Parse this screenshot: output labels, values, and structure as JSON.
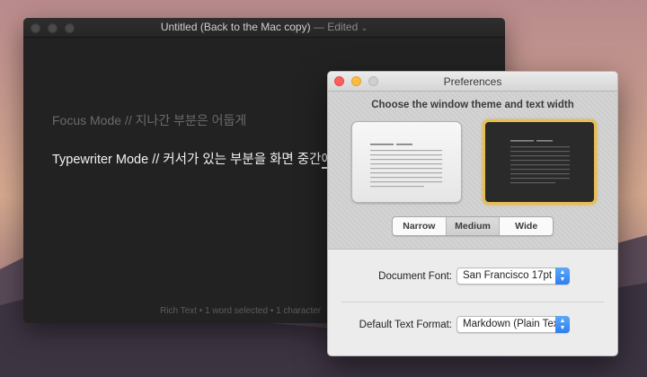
{
  "editor": {
    "title": "Untitled (Back to the Mac copy)",
    "edited_label": "— Edited",
    "focus_line": "Focus Mode // 지나간 부분은 어둡게",
    "typewriter_line_main": "Typewriter Mode // 커서가 있는 부분을 화면 중간",
    "typewriter_line_cursor": "에",
    "status": "Rich Text • 1 word selected • 1 character"
  },
  "preferences": {
    "title": "Preferences",
    "heading": "Choose the window theme and text width",
    "selected_theme": "dark",
    "width_options": [
      "Narrow",
      "Medium",
      "Wide"
    ],
    "selected_width": "Medium",
    "document_font_label": "Document Font:",
    "document_font_value": "San Francisco 17pt",
    "text_format_label": "Default Text Format:",
    "text_format_value": "Markdown (Plain Text)"
  },
  "colors": {
    "accent": "#e8bd52",
    "popup_blue": "#2d7ef0",
    "editor_bg": "#222222"
  }
}
